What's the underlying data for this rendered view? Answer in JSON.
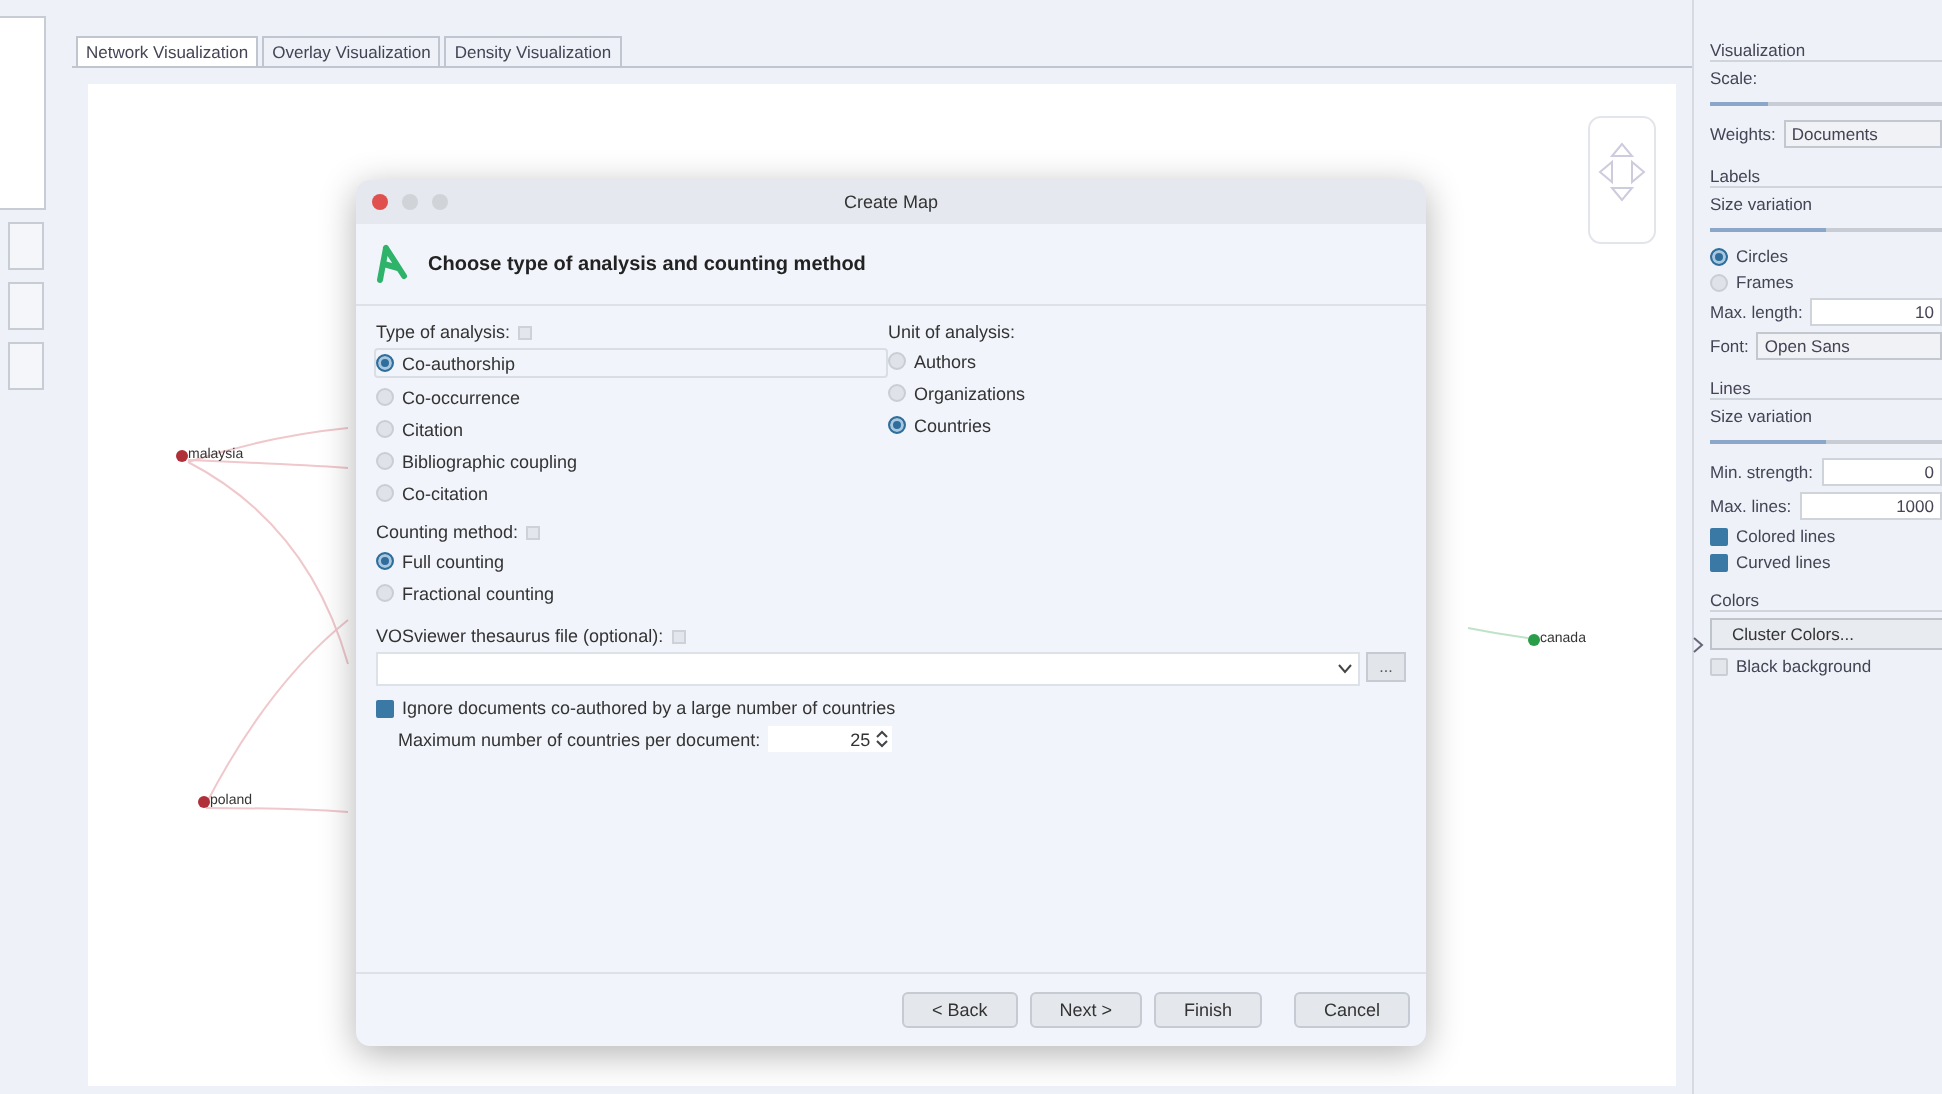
{
  "tabs": [
    {
      "label": "Network Visualization",
      "selected": true
    },
    {
      "label": "Overlay Visualization",
      "selected": false
    },
    {
      "label": "Density Visualization",
      "selected": false
    }
  ],
  "network": {
    "nodes": [
      {
        "label": "malaysia",
        "color": "#b0303a"
      },
      {
        "label": "poland",
        "color": "#b0303a"
      },
      {
        "label": "canada",
        "color": "#2a9d48"
      }
    ]
  },
  "dialog": {
    "title": "Create Map",
    "heading": "Choose type of analysis and counting method",
    "analysis_type": {
      "label": "Type of analysis:",
      "options": [
        {
          "label": "Co-authorship",
          "selected": true
        },
        {
          "label": "Co-occurrence",
          "selected": false
        },
        {
          "label": "Citation",
          "selected": false
        },
        {
          "label": "Bibliographic coupling",
          "selected": false
        },
        {
          "label": "Co-citation",
          "selected": false
        }
      ]
    },
    "unit": {
      "label": "Unit of analysis:",
      "options": [
        {
          "label": "Authors",
          "selected": false
        },
        {
          "label": "Organizations",
          "selected": false
        },
        {
          "label": "Countries",
          "selected": true
        }
      ]
    },
    "counting": {
      "label": "Counting method:",
      "options": [
        {
          "label": "Full counting",
          "selected": true
        },
        {
          "label": "Fractional counting",
          "selected": false
        }
      ]
    },
    "thesaurus": {
      "label": "VOSviewer thesaurus file (optional):",
      "browse": "..."
    },
    "ignore": {
      "label": "Ignore documents co-authored by a large number of countries",
      "checked": true
    },
    "max_countries": {
      "label": "Maximum number of countries per document:",
      "value": "25"
    },
    "buttons": [
      {
        "label": "< Back"
      },
      {
        "label": "Next >"
      },
      {
        "label": "Finish"
      },
      {
        "label": "Cancel"
      }
    ]
  },
  "panel": {
    "items": [
      {
        "kind": "heading",
        "label": "Visualization"
      },
      {
        "kind": "label",
        "label": "Scale:"
      },
      {
        "kind": "slider",
        "level": 0.25
      },
      {
        "kind": "select",
        "label": "Weights:",
        "value": "Documents"
      },
      {
        "kind": "heading",
        "label": "Labels"
      },
      {
        "kind": "label",
        "label": "Size variation"
      },
      {
        "kind": "slider",
        "level": 0.5
      },
      {
        "kind": "radio",
        "label": "Circles",
        "selected": true
      },
      {
        "kind": "radio",
        "label": "Frames",
        "selected": false
      },
      {
        "kind": "number",
        "label": "Max. length:",
        "value": "10"
      },
      {
        "kind": "select",
        "label": "Font:",
        "value": "Open Sans"
      },
      {
        "kind": "heading",
        "label": "Lines"
      },
      {
        "kind": "label",
        "label": "Size variation"
      },
      {
        "kind": "slider",
        "level": 0.5
      },
      {
        "kind": "number",
        "label": "Min. strength:",
        "value": "0"
      },
      {
        "kind": "number",
        "label": "Max. lines:",
        "value": "1000"
      },
      {
        "kind": "checkbox",
        "label": "Colored lines",
        "checked": true
      },
      {
        "kind": "checkbox",
        "label": "Curved lines",
        "checked": true
      },
      {
        "kind": "heading",
        "label": "Colors"
      },
      {
        "kind": "button",
        "label": "Cluster Colors..."
      },
      {
        "kind": "checkbox",
        "label": "Black background",
        "checked": false
      }
    ]
  }
}
